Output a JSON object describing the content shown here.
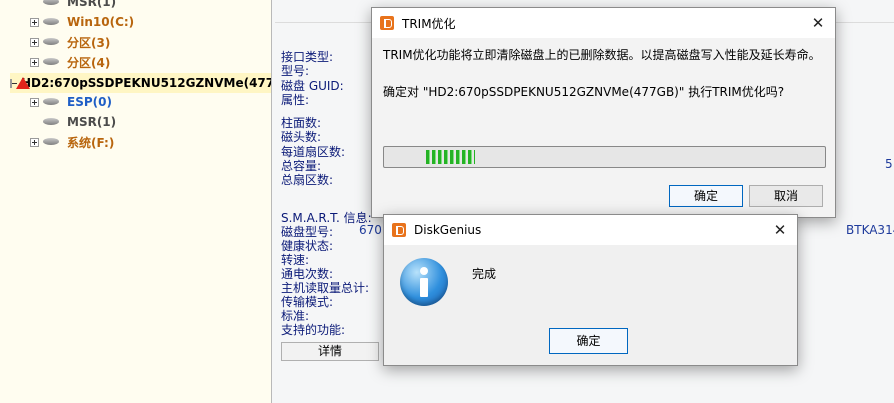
{
  "tree": {
    "items": [
      {
        "label": "MSR(1)",
        "color": "#4b4b4b"
      },
      {
        "label": "Win10(C:)",
        "color": "#b8650d"
      },
      {
        "label": "分区(3)",
        "color": "#b8650d"
      },
      {
        "label": "分区(4)",
        "color": "#b8650d"
      },
      {
        "label": "HD2:670pSSDPEKNU512GZNVMe(477",
        "color": "#000000"
      },
      {
        "label": "ESP(0)",
        "color": "#1f5ec6"
      },
      {
        "label": "MSR(1)",
        "color": "#4b4b4b"
      },
      {
        "label": "系统(F:)",
        "color": "#b8650d"
      }
    ]
  },
  "info": {
    "labels_top": [
      "接口类型:",
      "型号:",
      "磁盘 GUID:",
      "属性:"
    ],
    "labels_geometry": [
      "柱面数:",
      "磁头数:",
      "每道扇区数:",
      "总容量:",
      "总扇区数:"
    ],
    "labels_smart": [
      "S.M.A.R.T. 信息:",
      "磁盘型号:",
      "健康状态:",
      "转速:",
      "通电次数:",
      "主机读取量总计:",
      "传输模式:",
      "标准:",
      "支持的功能:"
    ],
    "disk_model_value": "670",
    "serial_value": "BTKA314",
    "capacity_partial": "5",
    "details_button": "详情"
  },
  "trim_dialog": {
    "title": "TRIM优化",
    "message1": "TRIM优化功能将立即清除磁盘上的已删除数据。以提高磁盘写入性能及延长寿命。",
    "message2": "确定对 \"HD2:670pSSDPEKNU512GZNVMe(477GB)\" 执行TRIM优化吗?",
    "progress": 0.11,
    "ok_label": "确定",
    "cancel_label": "取消"
  },
  "info_dialog": {
    "title": "DiskGenius",
    "message": "完成",
    "ok_label": "确定"
  },
  "colors": {
    "accent": "#0067c0",
    "progress_green": "#25b225",
    "app_icon": "#e8731c"
  }
}
